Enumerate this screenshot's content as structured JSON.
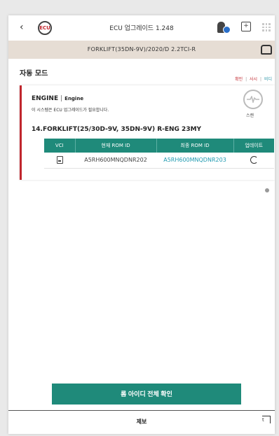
{
  "header": {
    "back_glyph": "‹",
    "logo_text": "ECU",
    "title": "ECU 업그레이드 1.248",
    "frame_glyph": "+"
  },
  "vehicle": {
    "name": "FORKLIFT(35DN-9V)/2020/D 2.2TCI-R"
  },
  "mode": {
    "title": "자동 모드",
    "links": {
      "confirm": "확인",
      "sep1": "|",
      "mid": "사시",
      "sep2": "|",
      "end": "비디"
    }
  },
  "engine_card": {
    "name": "ENGINE",
    "separator": "|",
    "sub_name": "Engine",
    "message": "이 시스템은 ECU 업그레이드가 필요합니다.",
    "scan_label": "스캔",
    "model": "14.FORKLIFT(25/30D-9V, 35DN-9V) R-ENG 23MY",
    "table": {
      "headers": [
        "VCI",
        "현재 ROM ID",
        "최종 ROM ID",
        "업데이트"
      ],
      "rows": [
        {
          "current_rom": "A5RH600MNQDNR202",
          "latest_rom": "A5RH600MNQDNR203"
        }
      ]
    }
  },
  "footer": {
    "confirm_button": "롬 아이디 전체 확인",
    "bottom_label": "제보",
    "corner_glyph": "t"
  },
  "colors": {
    "accent": "#1f8a7a",
    "alert_red": "#c0262d",
    "link_blue": "#2b95a8"
  },
  "icons": [
    "back-icon",
    "ecu-logo-icon",
    "user-badge-icon",
    "frame-icon",
    "grid-icon",
    "car-icon",
    "scan-icon",
    "vci-icon",
    "update-icon"
  ]
}
